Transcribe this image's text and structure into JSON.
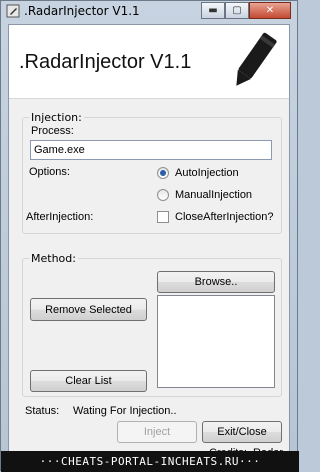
{
  "window": {
    "title": ".RadarInjector V1.1",
    "controls": {
      "minimize": "▬",
      "maximize": "▢",
      "close": "✕"
    }
  },
  "header": {
    "title": ".RadarInjector V1.1",
    "icon": "pen-icon"
  },
  "injection": {
    "group_label": "Injection:",
    "process_label": "Process:",
    "process_value": "Game.exe",
    "options_label": "Options:",
    "auto_injection": "AutoInjection",
    "manual_injection": "ManualInjection",
    "selected_option": "AutoInjection",
    "after_injection_label": "AfterInjection:",
    "close_after_injection": "CloseAfterInjection?",
    "close_after_checked": false
  },
  "method": {
    "group_label": "Method:",
    "browse": "Browse..",
    "remove_selected": "Remove Selected",
    "clear_list": "Clear List",
    "items": []
  },
  "status": {
    "label": "Status:",
    "text": "Wating For Injection.."
  },
  "footer": {
    "inject": "Inject",
    "inject_enabled": false,
    "exit": "Exit/Close",
    "credits": "Credits: .Radar"
  },
  "banner": {
    "text": "···CHEATS-PORTAL-INCHEATS.RU···"
  },
  "colors": {
    "accent": "#2b5ea8",
    "close": "#c44a33"
  }
}
